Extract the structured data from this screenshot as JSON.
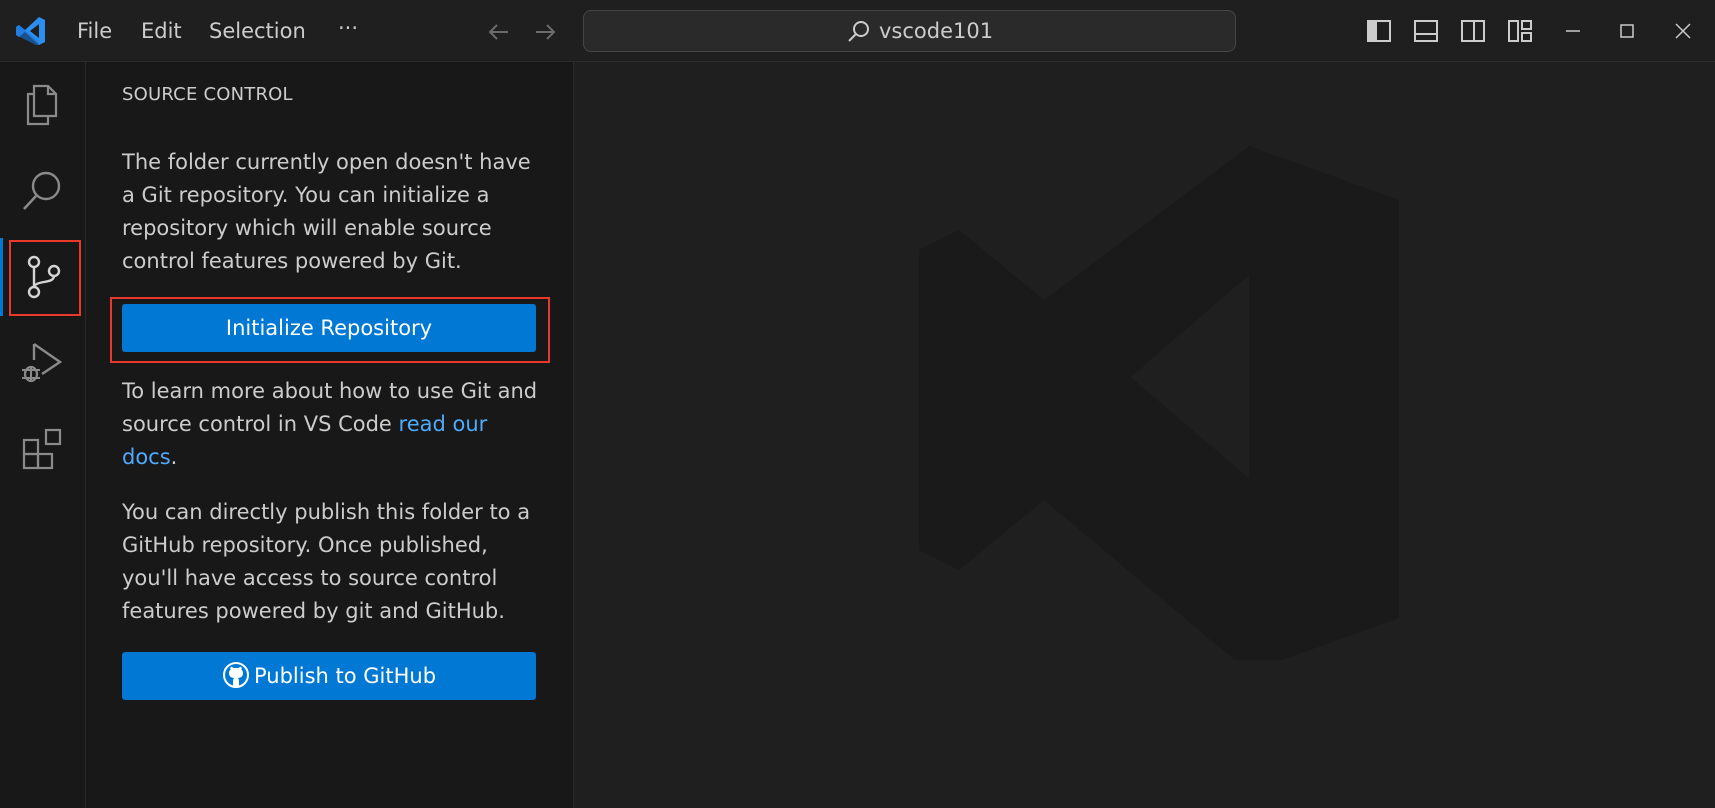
{
  "titlebar": {
    "menu": [
      "File",
      "Edit",
      "Selection",
      "···"
    ],
    "command_center_text": "vscode101"
  },
  "activity_bar": {
    "items": [
      "explorer-icon",
      "search-icon",
      "source-control-icon",
      "run-debug-icon",
      "extensions-icon"
    ],
    "active": "source-control-icon"
  },
  "sidebar": {
    "title": "SOURCE CONTROL",
    "intro": "The folder currently open doesn't have a Git repository. You can initialize a repository which will enable source control features powered by Git.",
    "init_button": "Initialize Repository",
    "learn_prefix": "To learn more about how to use Git and source control in VS Code ",
    "learn_link": "read our docs",
    "learn_suffix": ".",
    "publish_text": "You can directly publish this folder to a GitHub repository. Once published, you'll have access to source control features powered by git and GitHub.",
    "publish_button": "Publish to GitHub"
  },
  "colors": {
    "accent": "#0078d4",
    "link": "#4daafc",
    "highlight": "#e8392a"
  }
}
